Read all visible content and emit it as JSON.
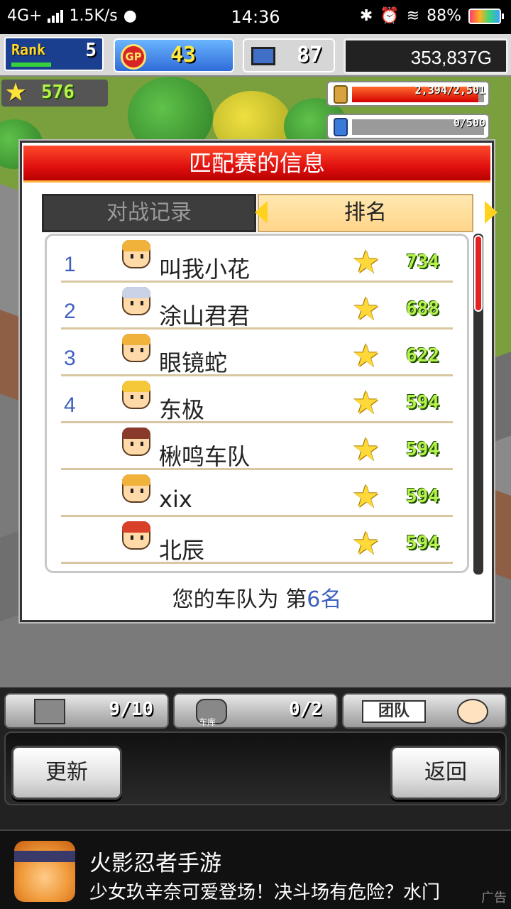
{
  "statusbar": {
    "network": "4G+",
    "speed": "1.5K/s",
    "time": "14:36",
    "battery": "88%"
  },
  "hud": {
    "rank_label": "Rank",
    "rank_value": "5",
    "rank_progress": 0.45,
    "gp_label": "GP",
    "gp_value": "43",
    "pc_value": "87",
    "money": "353,837G",
    "stars": "576",
    "fuel": "2,394/2,501",
    "fuel_fraction": 0.957,
    "parts": "0/500",
    "parts_fraction": 0.0
  },
  "dialog": {
    "title": "匹配赛的信息",
    "tab_record": "对战记录",
    "tab_rank": "排名",
    "your_rank_prefix": "您的车队为 第",
    "your_rank_num": "6",
    "your_rank_suffix": "名"
  },
  "ranking": [
    {
      "rank": "1",
      "name": "叫我小花",
      "score": "734",
      "hair": "#f0b23a"
    },
    {
      "rank": "2",
      "name": "涂山君君",
      "score": "688",
      "hair": "#c9d2e6"
    },
    {
      "rank": "3",
      "name": "眼镜蛇",
      "score": "622",
      "hair": "#f0b23a"
    },
    {
      "rank": "4",
      "name": "东极",
      "score": "594",
      "hair": "#f5c83a"
    },
    {
      "rank": "",
      "name": "楸鸣车队",
      "score": "594",
      "hair": "#8a3a2a"
    },
    {
      "rank": "",
      "name": "xix",
      "score": "594",
      "hair": "#f0b23a"
    },
    {
      "rank": "",
      "name": "北辰",
      "score": "594",
      "hair": "#d8402a"
    }
  ],
  "bottom": {
    "slot1_count": "9/10",
    "slot2_label": "车库",
    "slot2_count": "0/2",
    "slot3_label": "团队",
    "update_button": "更新",
    "back_button": "返回"
  },
  "ad": {
    "title": "火影忍者手游",
    "desc": "少女玖辛奈可爱登场！决斗场有危险？水门",
    "tag": "广告"
  }
}
